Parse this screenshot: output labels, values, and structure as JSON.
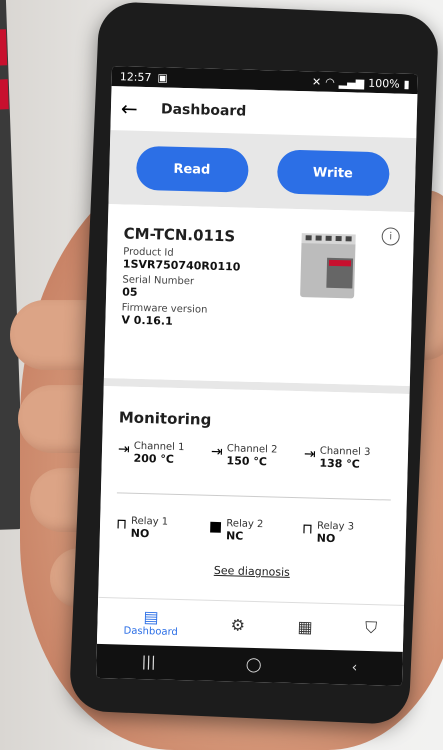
{
  "status": {
    "time": "12:57",
    "battery": "100%"
  },
  "appbar": {
    "title": "Dashboard"
  },
  "actions": {
    "read": "Read",
    "write": "Write"
  },
  "product": {
    "name": "CM-TCN.011S",
    "product_id_label": "Product Id",
    "product_id": "1SVR750740R0110",
    "serial_label": "Serial Number",
    "serial": "05",
    "firmware_label": "Firmware version",
    "firmware": "V 0.16.1"
  },
  "monitoring": {
    "title": "Monitoring",
    "channels": [
      {
        "label": "Channel 1",
        "value": "200 °C"
      },
      {
        "label": "Channel 2",
        "value": "150 °C"
      },
      {
        "label": "Channel 3",
        "value": "138 °C"
      }
    ],
    "relays": [
      {
        "label": "Relay 1",
        "value": "NO"
      },
      {
        "label": "Relay 2",
        "value": "NC"
      },
      {
        "label": "Relay 3",
        "value": "NO"
      }
    ],
    "diagnosis_link": "See diagnosis"
  },
  "bottom_nav": {
    "dashboard": "Dashboard"
  },
  "colors": {
    "accent": "#2c6fe6",
    "section_bg": "#e7e7e7"
  }
}
